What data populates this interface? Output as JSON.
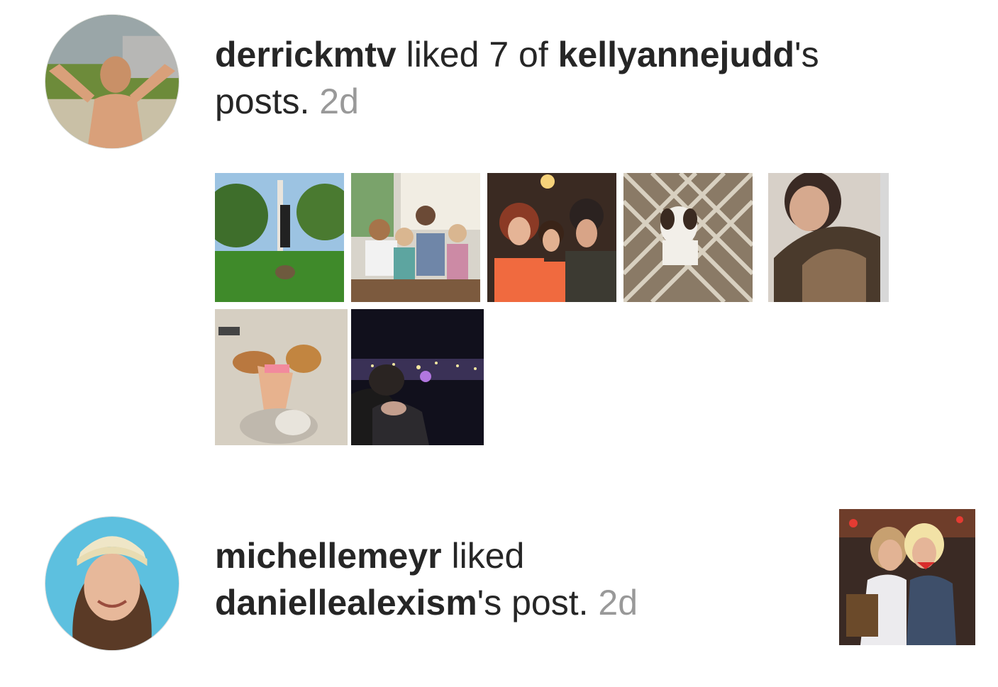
{
  "notifications": [
    {
      "user": "derrickmtv",
      "action_text": " liked 7 of ",
      "target_user": "kellyannejudd",
      "suffix": "'s",
      "suffix2": "posts. ",
      "time": "2d",
      "avatar_icon": "person-photo",
      "liked_post_count": 7
    },
    {
      "user": "michellemeyr",
      "action_text": " liked",
      "target_user": "daniellealexism",
      "suffix": "'s post. ",
      "time": "2d",
      "avatar_icon": "person-photo"
    }
  ],
  "colors": {
    "username": "#262626",
    "text": "#262626",
    "timestamp": "#999999"
  }
}
